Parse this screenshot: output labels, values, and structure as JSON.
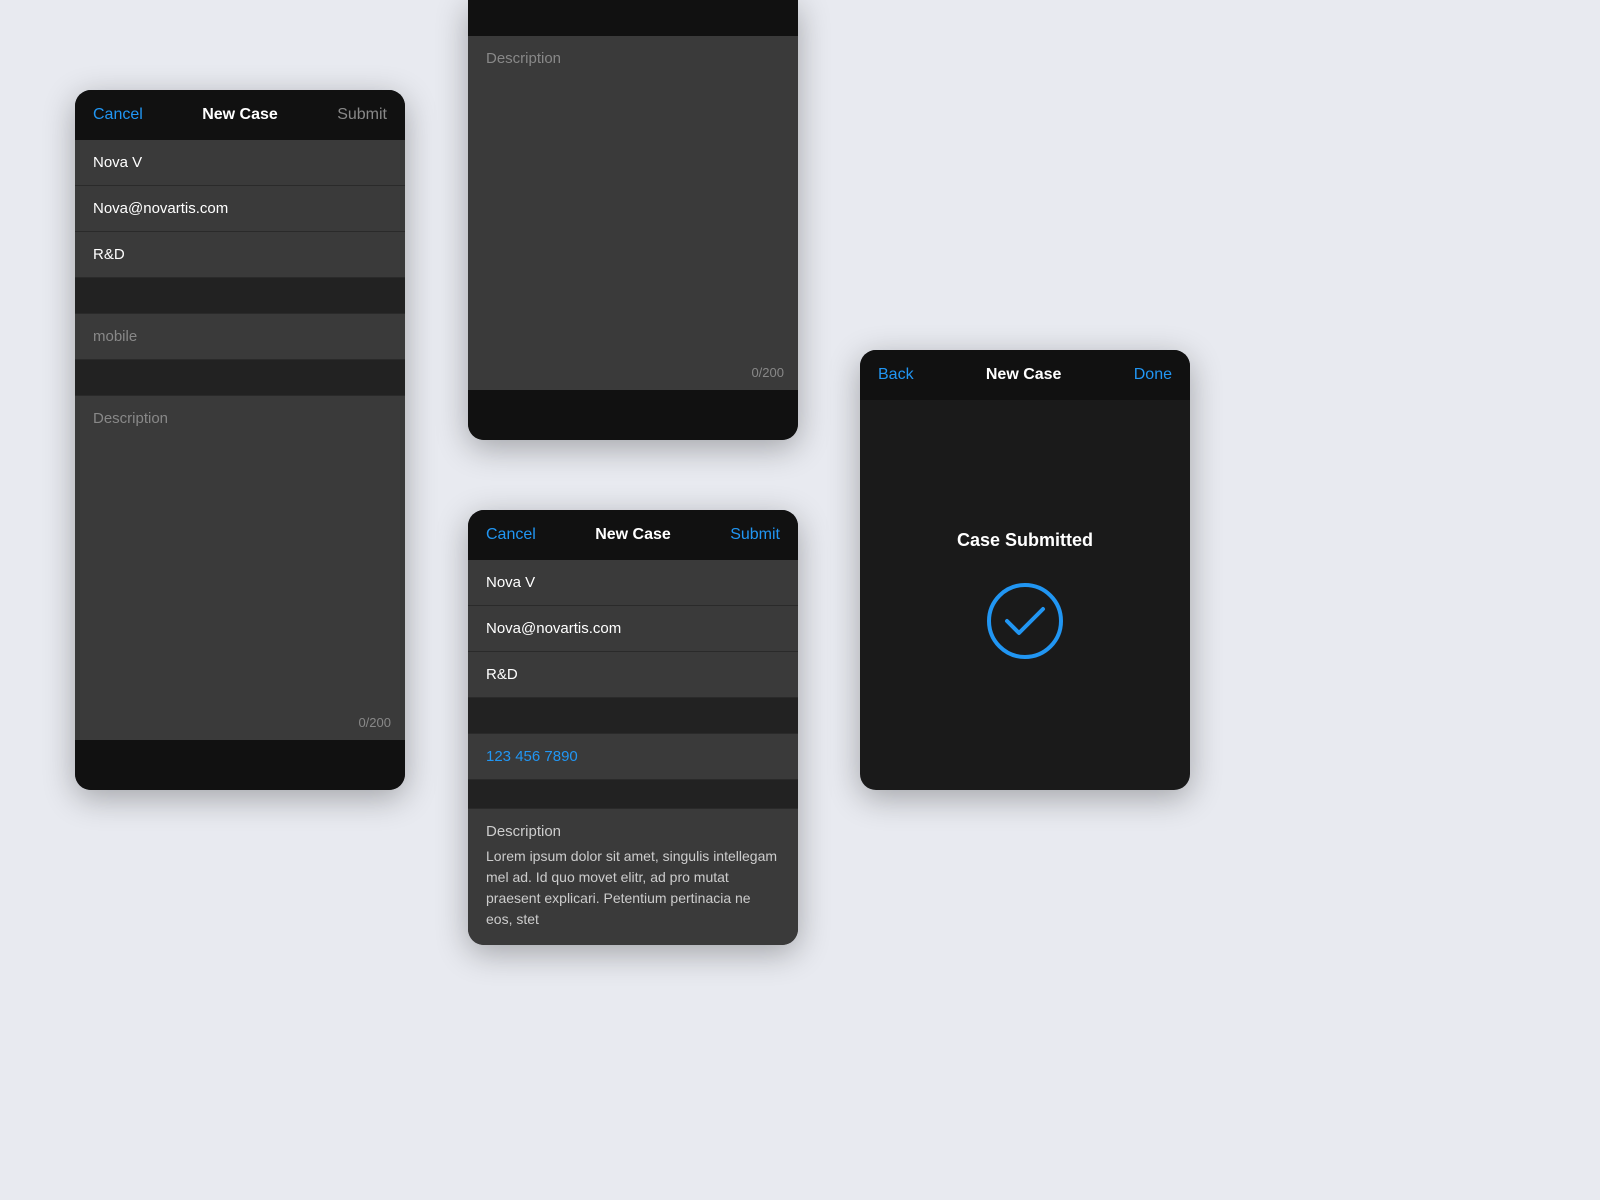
{
  "screen1": {
    "nav": {
      "cancel": "Cancel",
      "title": "New Case",
      "submit": "Submit"
    },
    "fields": {
      "name": "Nova V",
      "email": "Nova@novartis.com",
      "department": "R&D",
      "mobile_placeholder": "mobile",
      "description_placeholder": "Description",
      "counter": "0/200"
    }
  },
  "screen2": {
    "description_placeholder": "Description",
    "counter": "0/200"
  },
  "screen3": {
    "nav": {
      "cancel": "Cancel",
      "title": "New Case",
      "submit": "Submit"
    },
    "fields": {
      "name": "Nova V",
      "email": "Nova@novartis.com",
      "department": "R&D",
      "phone": "123 456 7890",
      "description_label": "Description",
      "description_text": "Lorem ipsum dolor sit amet, singulis intellegam mel ad. Id quo movet elitr, ad pro mutat praesent explicari. Petentium pertinacia ne eos, stet"
    }
  },
  "screen4": {
    "nav": {
      "back": "Back",
      "title": "New Case",
      "done": "Done"
    },
    "case_submitted": "Case Submitted"
  }
}
